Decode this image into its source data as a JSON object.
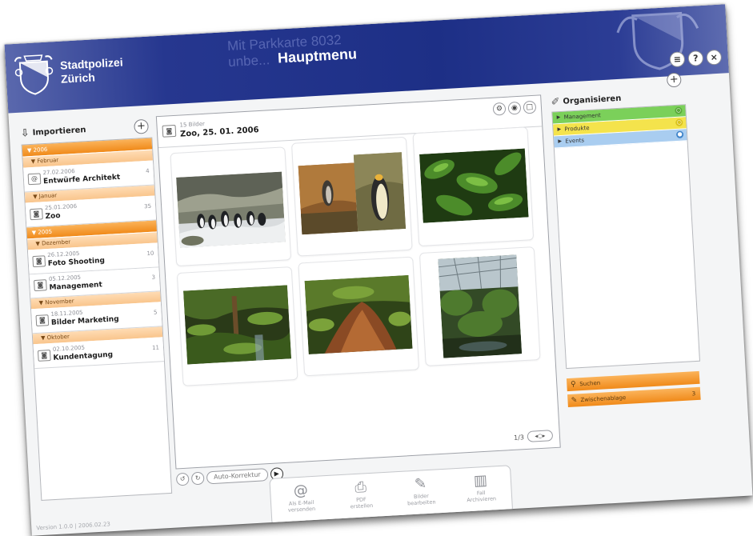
{
  "header": {
    "brand_line1": "Stadtpolizei",
    "brand_line2": "Zürich",
    "ghost_line1": "Mit Parkkarte 8032",
    "ghost_line2": "unbe...",
    "title": "Hauptmenu",
    "buttons": [
      "≡",
      "?",
      "×"
    ]
  },
  "left_panel": {
    "title": "Importieren",
    "plus": "+",
    "tree": [
      {
        "type": "year",
        "label": "2006"
      },
      {
        "type": "month",
        "label": "Februar"
      },
      {
        "type": "event",
        "date": "27.02.2006",
        "name": "Entwürfe Architekt",
        "count": "4",
        "icon": "@"
      },
      {
        "type": "month",
        "label": "Januar"
      },
      {
        "type": "event",
        "date": "25.01.2006",
        "name": "Zoo",
        "count": "35",
        "icon": "◙"
      },
      {
        "type": "year",
        "label": "2005"
      },
      {
        "type": "month",
        "label": "Dezember"
      },
      {
        "type": "event",
        "date": "26.12.2005",
        "name": "Foto Shooting",
        "count": "10",
        "icon": "◙"
      },
      {
        "type": "event",
        "date": "05.12.2005",
        "name": "Management",
        "count": "3",
        "icon": "◙"
      },
      {
        "type": "month",
        "label": "November"
      },
      {
        "type": "event",
        "date": "18.11.2005",
        "name": "Bilder Marketing",
        "count": "5",
        "icon": "◙"
      },
      {
        "type": "month",
        "label": "Oktober"
      },
      {
        "type": "event",
        "date": "02.10.2005",
        "name": "Kundentagung",
        "count": "11",
        "icon": "◙"
      }
    ]
  },
  "center": {
    "count": "15 Bilder",
    "title": "Zoo, 25. 01. 2006",
    "header_buttons": [
      "⚙",
      "◉",
      "□"
    ],
    "thumbs": [
      "penguins",
      "penguin-rocks",
      "green-leaves",
      "rainforest",
      "forest-roots",
      "greenhouse"
    ],
    "pager": "1/3",
    "pager_ctrl": "◂○▸"
  },
  "controls": {
    "rotate_left": "↺",
    "rotate_right": "↻",
    "auto_correct": "Auto-Korrektur",
    "play": "▶"
  },
  "actions": [
    {
      "icon": "@",
      "label1": "Als E-Mail",
      "label2": "versenden"
    },
    {
      "icon": "⎙",
      "label1": "PDF",
      "label2": "erstellen"
    },
    {
      "icon": "✎",
      "label1": "Bilder",
      "label2": "bearbeiten"
    },
    {
      "icon": "▥",
      "label1": "Fall",
      "label2": "Archivieren"
    }
  ],
  "footer": "Version 1.0.0 | 2006.02.23",
  "right_panel": {
    "title": "Organisieren",
    "plus": "+",
    "categories": [
      {
        "label": "Management",
        "color": "#7bd05a",
        "dot": "#5aa93a",
        "dot_text": "○"
      },
      {
        "label": "Produkte",
        "color": "#f4e34c",
        "dot": "#d9c21c",
        "dot_text": "○"
      },
      {
        "label": "Events",
        "color": "#a9cdf0",
        "dot": "#3e83c9",
        "dot_text": "●"
      }
    ],
    "search": "Suchen",
    "clipboard": "Zwischenablage",
    "clipboard_count": "3"
  }
}
